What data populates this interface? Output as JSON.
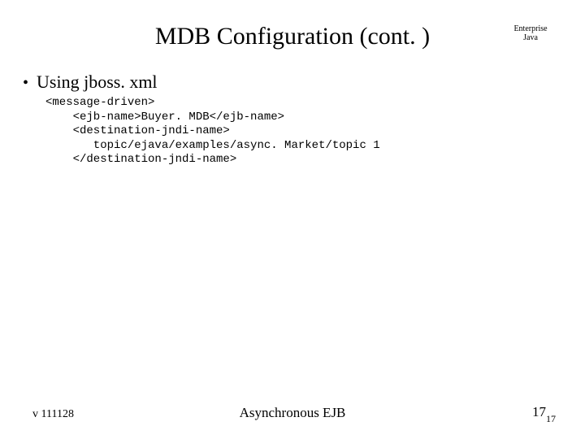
{
  "header": {
    "title": "MDB Configuration (cont. )",
    "corner_line1": "Enterprise",
    "corner_line2": "Java"
  },
  "body": {
    "bullet_text": "Using jboss. xml",
    "code": "<message-driven>\n    <ejb-name>Buyer. MDB</ejb-name>\n    <destination-jndi-name>\n       topic/ejava/examples/async. Market/topic 1\n    </destination-jndi-name>"
  },
  "footer": {
    "version": "v 111128",
    "center": "Asynchronous EJB",
    "page_main": "17",
    "page_sub": "17"
  }
}
